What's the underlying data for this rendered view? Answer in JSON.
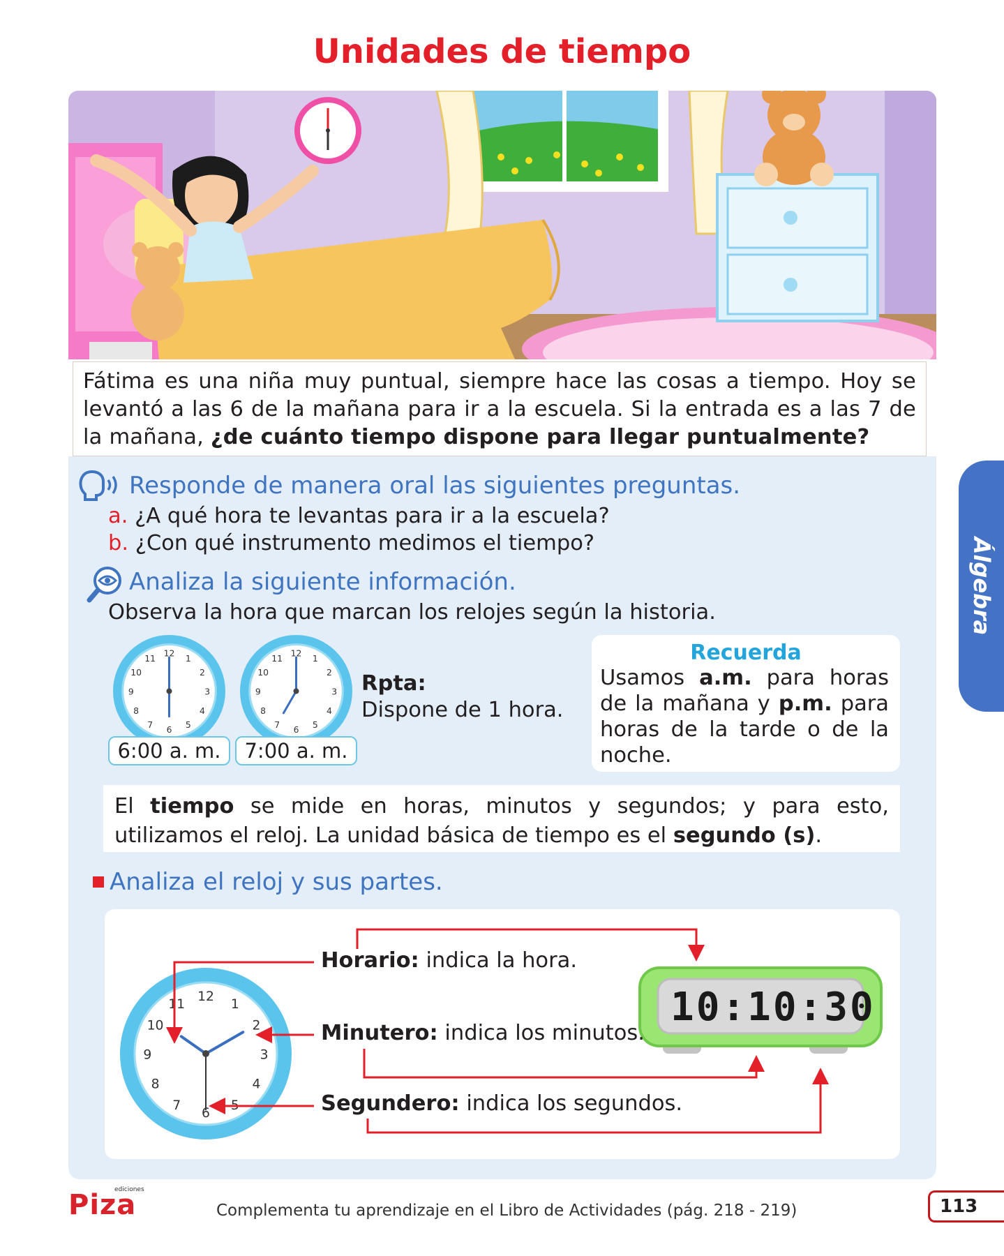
{
  "title": "Unidades de tiempo",
  "story": {
    "text": "Fátima es una niña muy puntual, siempre hace las cosas a tiempo. Hoy se levantó a las 6 de la mañana para ir a la escuela. Si la entrada es a las 7 de la mañana, ",
    "question": "¿de cuánto tiempo dispone para llegar puntualmente?"
  },
  "oral": {
    "heading": "Responde de manera oral las siguientes preguntas.",
    "items": [
      {
        "label": "a.",
        "text": "¿A qué hora te levantas para ir a la escuela?"
      },
      {
        "label": "b.",
        "text": "¿Con qué instrumento medimos el tiempo?"
      }
    ]
  },
  "analyze": {
    "heading": "Analiza la siguiente información.",
    "instruction": "Observa la hora que marcan los relojes según la historia."
  },
  "clocks": [
    {
      "time_label": "6:00 a. m.",
      "hour": 6,
      "minute": 0
    },
    {
      "time_label": "7:00 a. m.",
      "hour": 7,
      "minute": 0
    }
  ],
  "answer": {
    "label": "Rpta:",
    "text": "Dispone de 1 hora."
  },
  "recuerda": {
    "title": "Recuerda",
    "p1": "Usamos ",
    "am": "a.m.",
    "p2": " para horas de la mañana y ",
    "pm": "p.m.",
    "p3": " para horas de la tarde o de la noche."
  },
  "tiempo_info": {
    "p1": "El ",
    "b1": "tiempo",
    "p2": " se mide en horas, minutos y segundos; y para esto, utilizamos el reloj. La unidad básica de tiempo es el ",
    "b2": "segundo (s)",
    "p3": "."
  },
  "parts": {
    "heading": "Analiza el reloj y sus partes.",
    "items": [
      {
        "term": "Horario:",
        "desc": " indica la hora."
      },
      {
        "term": "Minutero:",
        "desc": " indica los minutos."
      },
      {
        "term": "Segundero:",
        "desc": " indica los segundos."
      }
    ],
    "digital": "10:10:30",
    "analog": {
      "hour": 10,
      "minute": 10,
      "second": 30
    }
  },
  "side_tab": "Álgebra",
  "footer": "Complementa tu aprendizaje en el Libro de Actividades (pág. 218 - 219)",
  "page_number": "113",
  "logo": {
    "name": "Piza",
    "small": "ediciones"
  },
  "colors": {
    "title_red": "#e3202a",
    "heading_blue": "#3f74c0",
    "panel_blue": "#e4eef8",
    "tab_blue": "#4472c4",
    "clock_cyan": "#5bc4ec",
    "digital_green": "#8ee26a"
  }
}
